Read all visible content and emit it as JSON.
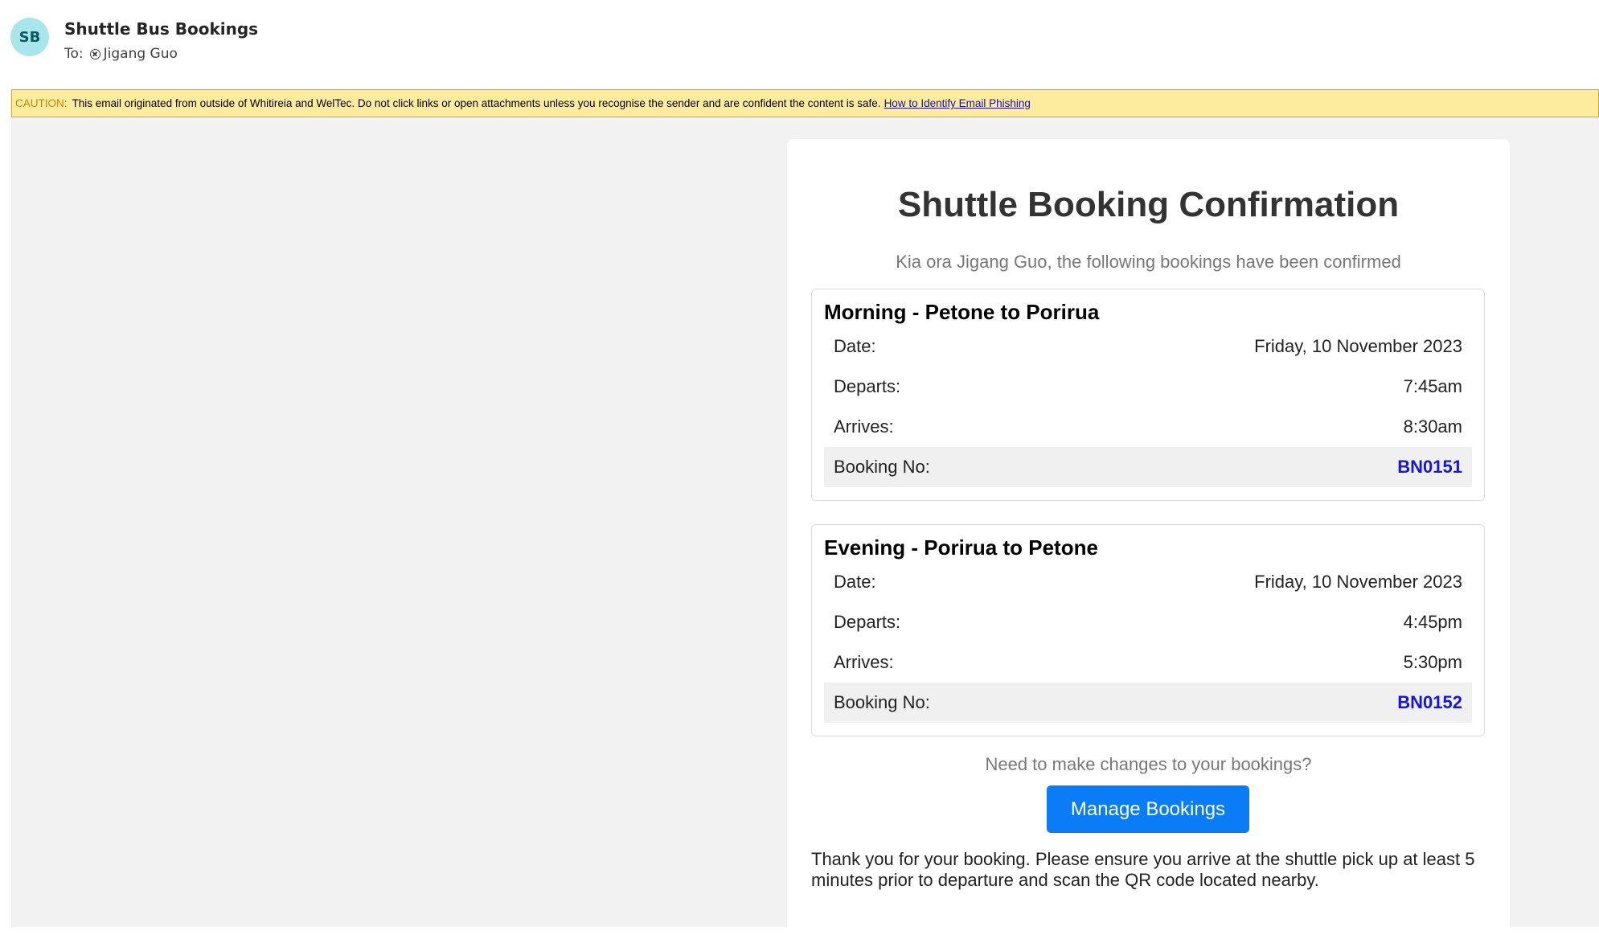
{
  "header": {
    "avatar_initials": "SB",
    "sender_name": "Shuttle Bus Bookings",
    "to_label": "To:",
    "recipient": "Jigang Guo"
  },
  "caution": {
    "label": "CAUTION:",
    "message": "This email originated from outside of Whitireia and WelTec. Do not click links or open attachments unless you recognise the sender and are confident the content is safe.",
    "link_text": "How to Identify Email Phishing"
  },
  "email": {
    "title": "Shuttle Booking Confirmation",
    "greeting": "Kia ora Jigang Guo, the following bookings have been confirmed",
    "bookings": [
      {
        "title": "Morning - Petone to Porirua",
        "date_label": "Date:",
        "date": "Friday, 10 November 2023",
        "departs_label": "Departs:",
        "departs": "7:45am",
        "arrives_label": "Arrives:",
        "arrives": "8:30am",
        "booking_no_label": "Booking No:",
        "booking_no": "BN0151"
      },
      {
        "title": "Evening - Porirua to Petone",
        "date_label": "Date:",
        "date": "Friday, 10 November 2023",
        "departs_label": "Departs:",
        "departs": "4:45pm",
        "arrives_label": "Arrives:",
        "arrives": "5:30pm",
        "booking_no_label": "Booking No:",
        "booking_no": "BN0152"
      }
    ],
    "changes_prompt": "Need to make changes to your bookings?",
    "manage_button": "Manage Bookings",
    "footer_text": "Thank you for your booking. Please ensure you arrive at the shuttle pick up at least 5 minutes prior to departure and scan the QR code located nearby."
  },
  "colors": {
    "accent_button": "#0a7cf5",
    "booking_number": "#1515e0",
    "caution_bg": "#fdec9d",
    "avatar_bg": "#a9e6ec"
  }
}
